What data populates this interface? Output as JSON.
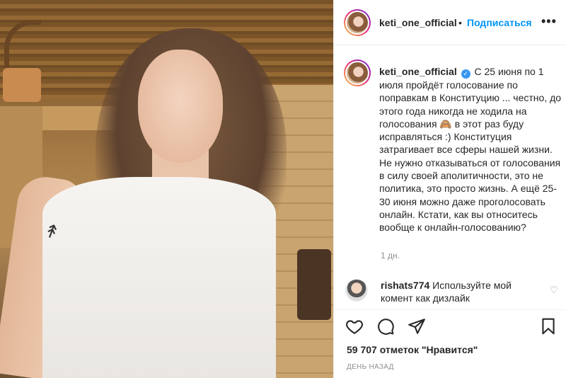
{
  "post": {
    "username": "keti_one_official",
    "follow_label": "Подписаться",
    "separator": "•",
    "more_label": "•••",
    "caption": {
      "username": "keti_one_official",
      "verified_mark": "✓",
      "text_part1": "С 25 июня по 1 июля пройдёт голосование по поправкам в Конституцию ... честно, до этого года никогда не ходила на голосования ",
      "emoji": "🙈",
      "text_part2": " в этот раз буду исправляться :) Конституция затрагивает все сферы нашей жизни. Не нужно отказываться от голосования в силу своей аполитичности, это не политика, это просто жизнь. А ещё 25-30 июня можно даже проголосовать онлайн. Кстати, как вы относитесь вообще к онлайн-голосованию?",
      "time": "1 дн."
    },
    "comments": [
      {
        "username": "rishats774",
        "text": "Используйте мой комент как дизлайк",
        "heart": "♡"
      }
    ],
    "likes_text": "59 707 отметок \"Нравится\"",
    "date": "ДЕНЬ НАЗАД"
  },
  "icons": {
    "like": "heart-icon",
    "comment": "comment-bubble-icon",
    "share": "paper-plane-icon",
    "save": "bookmark-icon"
  },
  "colors": {
    "accent": "#0095f6",
    "verified": "#3897f0",
    "muted": "#8e8e8e",
    "text": "#262626"
  }
}
